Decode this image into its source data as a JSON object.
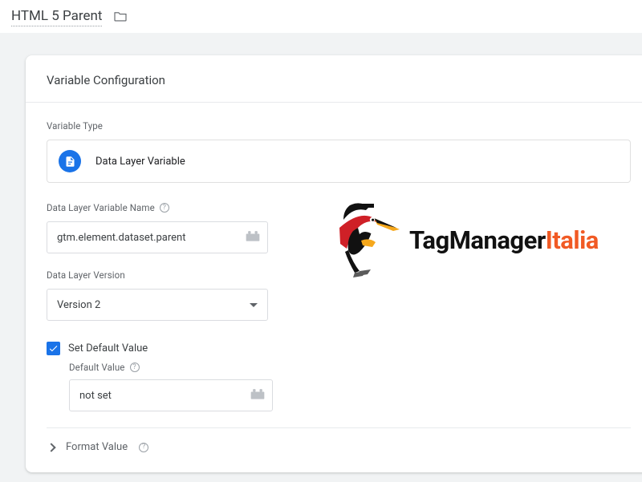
{
  "header": {
    "title": "HTML 5 Parent"
  },
  "card": {
    "title": "Variable Configuration",
    "type_section_label": "Variable Type",
    "type_name": "Data Layer Variable",
    "dlv_name_label": "Data Layer Variable Name",
    "dlv_name_value": "gtm.element.dataset.parent",
    "version_label": "Data Layer Version",
    "version_value": "Version 2",
    "set_default_label": "Set Default Value",
    "default_value_label": "Default Value",
    "default_value": "not set",
    "format_value_label": "Format Value"
  },
  "logo": {
    "text_main": "TagManager",
    "text_accent": "Italia"
  }
}
